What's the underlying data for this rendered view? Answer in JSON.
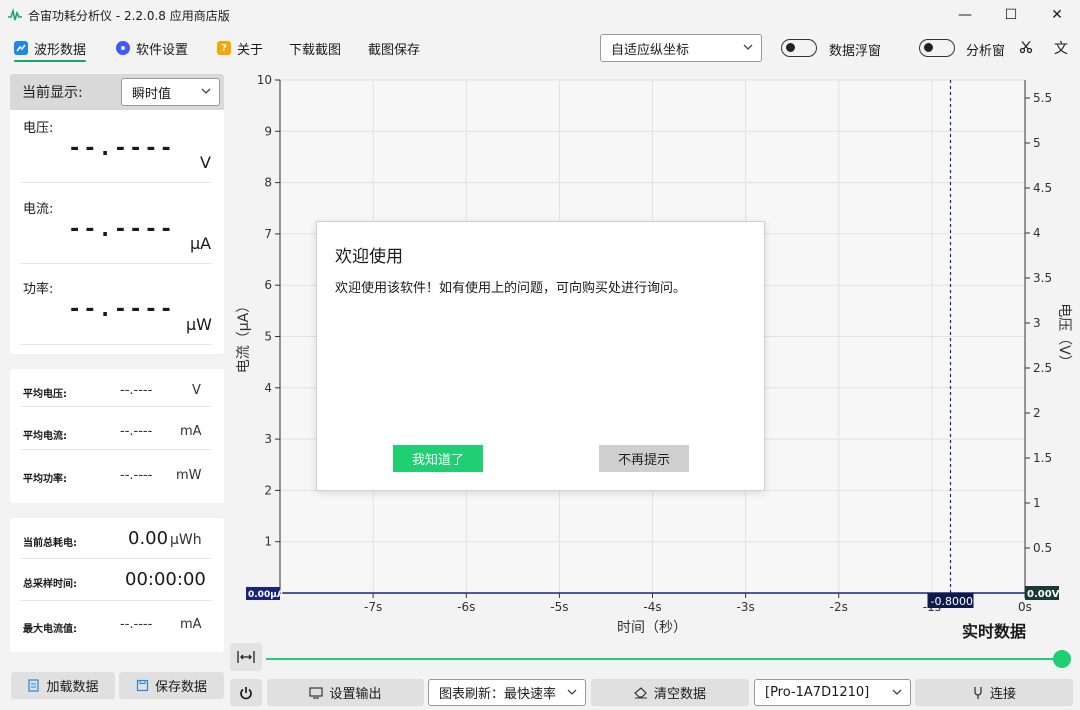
{
  "window": {
    "title": "合宙功耗分析仪 - 2.2.0.8 应用商店版",
    "minimize": "—",
    "maximize": "☐",
    "close": "✕"
  },
  "toolbar": {
    "waveform": "波形数据",
    "settings": "软件设置",
    "about": "关于",
    "download_capture": "下载截图",
    "save_capture": "截图保存",
    "axis_mode": "自适应纵坐标",
    "data_float_window": "数据浮窗",
    "analysis_window": "分析窗",
    "colors": {
      "waveform_icon": "#1e88e5",
      "settings_icon": "#3d5afe",
      "about_icon": "#f5a800",
      "accent": "#1aa36a"
    }
  },
  "left": {
    "current_display_label": "当前显示:",
    "current_display_value": "瞬时值",
    "voltage_label": "电压:",
    "voltage_value": "--.----",
    "voltage_unit": "V",
    "current_label": "电流:",
    "current_value": "--.----",
    "current_unit": "μA",
    "power_label": "功率:",
    "power_value": "--.----",
    "power_unit": "μW",
    "avg_voltage_label": "平均电压:",
    "avg_voltage_value": "--.----",
    "avg_voltage_unit": "V",
    "avg_current_label": "平均电流:",
    "avg_current_value": "--.----",
    "avg_current_unit": "mA",
    "avg_power_label": "平均功率:",
    "avg_power_value": "--.----",
    "avg_power_unit": "mW",
    "total_energy_label": "当前总耗电:",
    "total_energy_value": "0.00",
    "total_energy_unit": "μWh",
    "total_time_label": "总采样时间:",
    "total_time_value": "00:00:00",
    "max_current_label": "最大电流值:",
    "max_current_value": "--.----",
    "max_current_unit": "mA",
    "load_button": "加载数据",
    "save_button": "保存数据"
  },
  "dialog": {
    "title": "欢迎使用",
    "message": "欢迎使用该软件！如有使用上的问题，可向购买处进行询问。",
    "ok": "我知道了",
    "no_more": "不再提示"
  },
  "bottom": {
    "realtime_label": "实时数据",
    "set_output": "设置输出",
    "refresh_label": "图表刷新：最快速率",
    "clear_data": "清空数据",
    "device": "[Pro-1A7D1210]",
    "connect": "连接"
  },
  "chart_data": {
    "type": "line",
    "xlabel": "时间（秒）",
    "ylabel": "电流（μA）",
    "y2label": "电压（V）",
    "x_ticks": [
      "-7s",
      "-6s",
      "-5s",
      "-4s",
      "-3s",
      "-2s",
      "-1s",
      "0s"
    ],
    "x_tick_values": [
      -7,
      -6,
      -5,
      -4,
      -3,
      -2,
      -1,
      0
    ],
    "xlim": [
      -8,
      0
    ],
    "y_ticks": [
      1,
      2,
      3,
      4,
      5,
      6,
      7,
      8,
      9,
      10
    ],
    "ylim": [
      0,
      10
    ],
    "y2_ticks": [
      0.5,
      1,
      1.5,
      2,
      2.5,
      3,
      3.5,
      4,
      4.5,
      5,
      5.5
    ],
    "y2lim": [
      0,
      5.7
    ],
    "cursor_x": -0.8,
    "cursor_label": "-0.8000",
    "left_badge": "0.00μA",
    "right_badge": "0.00V",
    "grid": true,
    "series": []
  }
}
